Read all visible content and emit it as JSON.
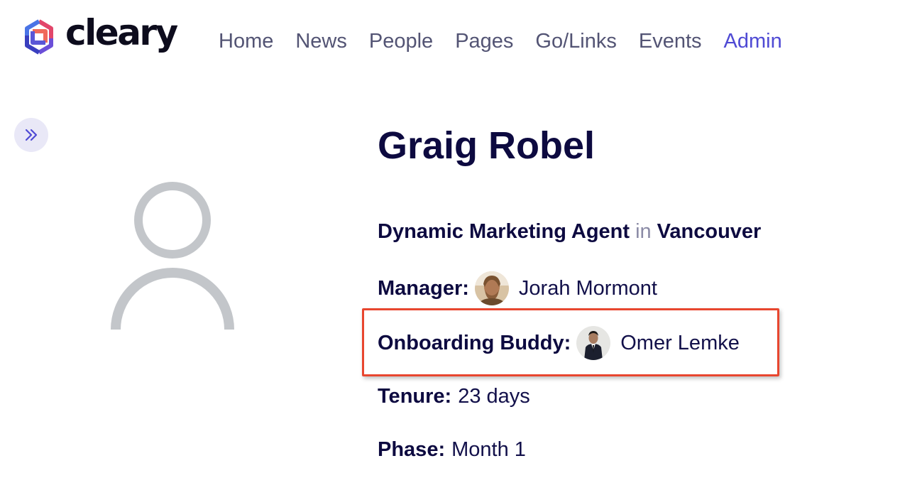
{
  "brand": {
    "name": "cleary"
  },
  "nav": {
    "items": [
      {
        "label": "Home"
      },
      {
        "label": "News"
      },
      {
        "label": "People"
      },
      {
        "label": "Pages"
      },
      {
        "label": "Go/Links"
      },
      {
        "label": "Events"
      },
      {
        "label": "Admin"
      }
    ],
    "active": "Admin"
  },
  "sidebar_toggle": {
    "icon": "chevrons-right-icon"
  },
  "profile": {
    "name": "Graig Robel",
    "title": "Dynamic Marketing Agent",
    "location_connector": "in",
    "location": "Vancouver",
    "manager_label": "Manager:",
    "manager_name": "Jorah Mormont",
    "buddy_label": "Onboarding Buddy:",
    "buddy_name": "Omer Lemke",
    "tenure_label": "Tenure:",
    "tenure_value": "23 days",
    "phase_label": "Phase:",
    "phase_value": "Month 1"
  },
  "colors": {
    "accent": "#4f4ad4",
    "highlight": "#e8462f",
    "heading": "#0d0a40",
    "nav_text": "#535474"
  }
}
